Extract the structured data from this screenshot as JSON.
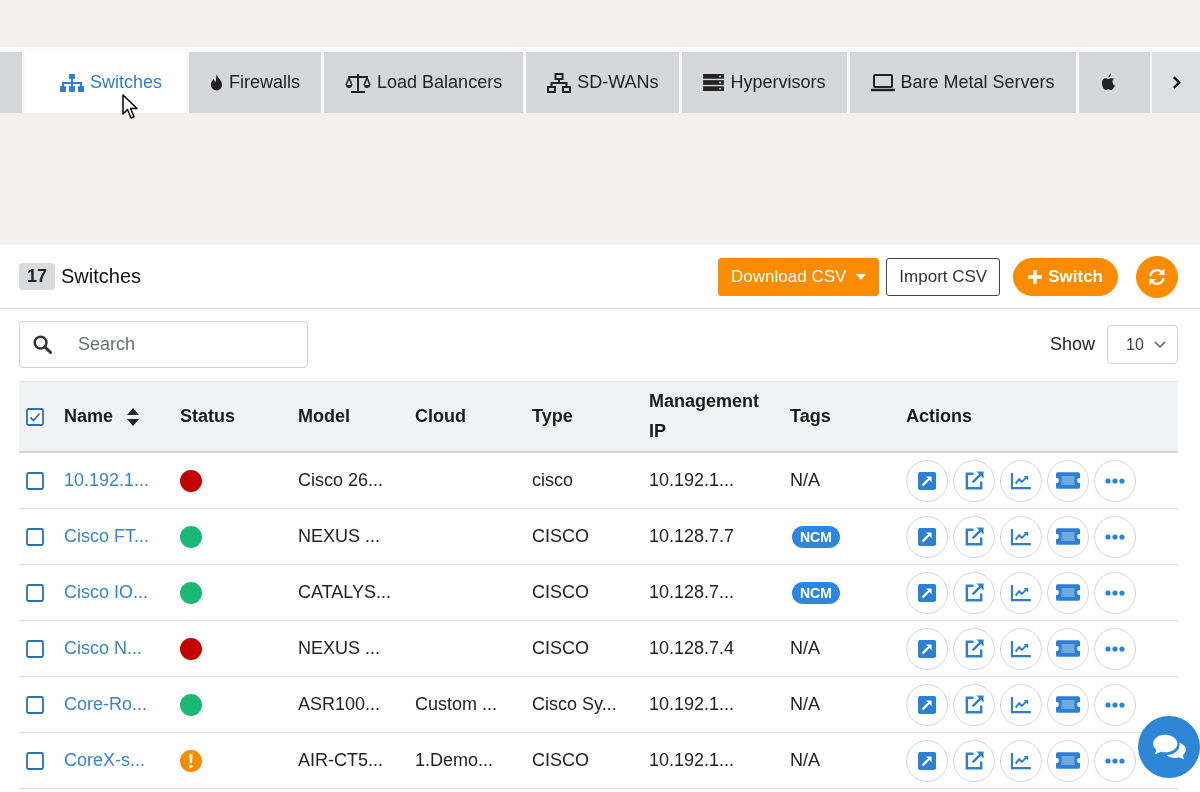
{
  "tabs": [
    {
      "kind": "clipped_start",
      "selected": false
    },
    {
      "kind": "full",
      "label": "Switches",
      "selected": true
    },
    {
      "kind": "full",
      "label": "Firewalls",
      "selected": false
    },
    {
      "kind": "full",
      "label": "Load Balancers",
      "selected": false
    },
    {
      "kind": "full",
      "label": "SD-WANs",
      "selected": false
    },
    {
      "kind": "full",
      "label": "Hypervisors",
      "selected": false
    },
    {
      "kind": "full",
      "label": "Bare Metal Servers",
      "selected": false
    },
    {
      "kind": "clipped_end",
      "selected": false
    }
  ],
  "panel": {
    "count": "17",
    "title": "Switches",
    "buttons": [
      {
        "kind": "dropdown",
        "label": "Download CSV"
      },
      {
        "kind": "outline",
        "label": "Import CSV"
      },
      {
        "kind": "add",
        "label": "Switch"
      },
      {
        "kind": "refresh"
      }
    ]
  },
  "search": {
    "placeholder": "Search"
  },
  "page_size": {
    "label": "Show",
    "value": "10"
  },
  "table": {
    "select_all": {
      "checked": true
    },
    "columns": [
      {
        "label": "Name",
        "sortable": true
      },
      {
        "label": "Status",
        "sortable": false
      },
      {
        "label": "Model",
        "sortable": false
      },
      {
        "label": "Cloud",
        "sortable": false
      },
      {
        "label": "Type",
        "sortable": false
      },
      {
        "label": "Management IP",
        "sortable": false
      },
      {
        "label": "Tags",
        "sortable": false
      },
      {
        "label": "Actions",
        "sortable": false
      }
    ],
    "rows": [
      {
        "checked": false,
        "name": "10.192.1...",
        "status": {
          "kind": "dot",
          "color": "#c30000"
        },
        "model": "Cisco 26...",
        "type": "cisco",
        "management_ip": "10.192.1...",
        "tag": {
          "kind": "text",
          "label": "N/A"
        }
      },
      {
        "checked": false,
        "name": "Cisco FT...",
        "status": {
          "kind": "dot",
          "color": "#1bb978"
        },
        "model": "NEXUS ...",
        "type": "CISCO",
        "management_ip": "10.128.7.7",
        "tag": {
          "kind": "badge",
          "label": "NCM"
        }
      },
      {
        "checked": false,
        "name": "Cisco IO...",
        "status": {
          "kind": "dot",
          "color": "#1bb978"
        },
        "model": "CATALYS...",
        "type": "CISCO",
        "management_ip": "10.128.7...",
        "tag": {
          "kind": "badge",
          "label": "NCM"
        }
      },
      {
        "checked": false,
        "name": "Cisco N...",
        "status": {
          "kind": "dot",
          "color": "#c30000"
        },
        "model": "NEXUS ...",
        "type": "CISCO",
        "management_ip": "10.128.7.4",
        "tag": {
          "kind": "text",
          "label": "N/A"
        }
      },
      {
        "checked": false,
        "name": "Core-Ro...",
        "status": {
          "kind": "dot",
          "color": "#1bb978"
        },
        "model": "ASR100...",
        "cloud": "Custom ...",
        "type": "Cisco Sy...",
        "management_ip": "10.192.1...",
        "tag": {
          "kind": "text",
          "label": "N/A"
        }
      },
      {
        "checked": false,
        "name": "CoreX-s...",
        "status": {
          "kind": "warning",
          "color": "#f28c00"
        },
        "model": "AIR-CT5...",
        "cloud": "1.Demo...",
        "type": "CISCO",
        "management_ip": "10.192.1...",
        "tag": {
          "kind": "text",
          "label": "N/A"
        }
      }
    ]
  }
}
